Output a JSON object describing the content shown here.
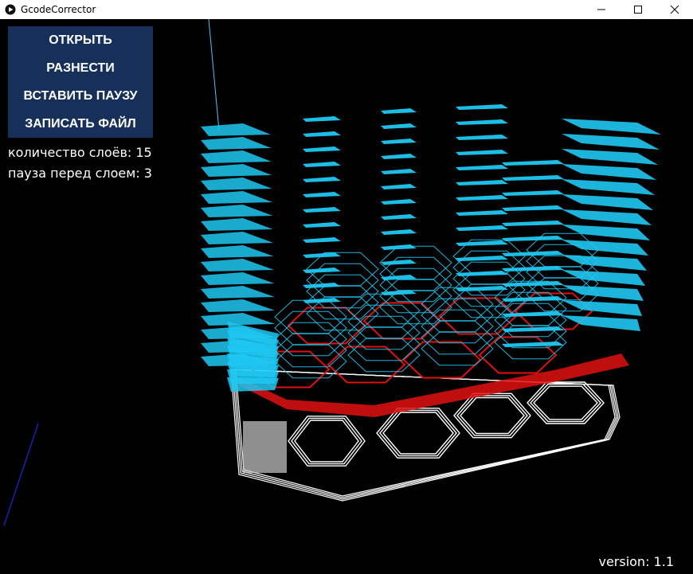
{
  "window": {
    "title": "GcodeCorrector",
    "controls": {
      "minimize": "—",
      "maximize": "☐",
      "close": "✕"
    }
  },
  "menu": {
    "open_label": "ОТКРЫТЬ",
    "spread_label": "РАЗНЕСТИ",
    "insert_pause_label": "ВСТАВИТЬ ПАУЗУ",
    "write_file_label": "ЗАПИСАТЬ ФАЙЛ"
  },
  "info": {
    "layer_count": "количество слоёв: 15",
    "pause_before_layer": "пауза перед слоем: 3"
  },
  "footer": {
    "version": "version: 1.1"
  },
  "colors": {
    "menu_bg": "#17305a",
    "layer_cyan": "#1fc8f2",
    "layer_red": "#e01010",
    "layer_white": "#ffffff",
    "background": "#000000"
  }
}
